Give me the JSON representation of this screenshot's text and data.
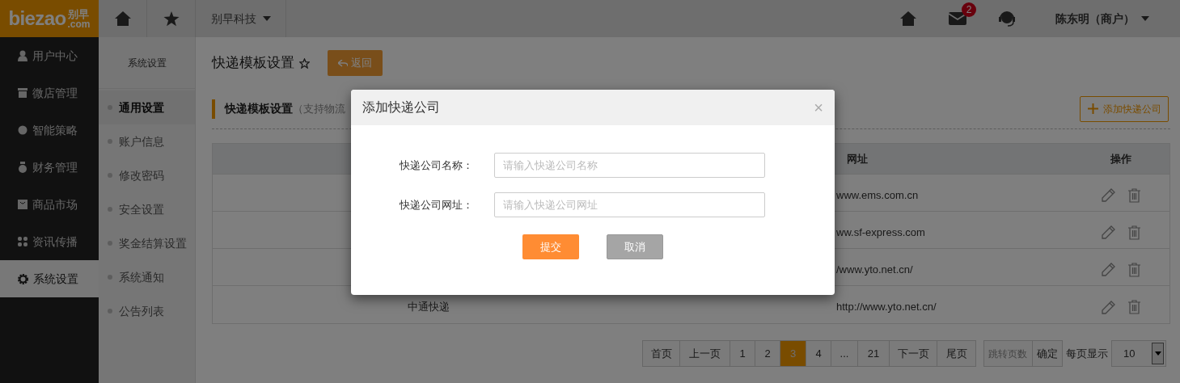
{
  "logo": {
    "text": "biezao",
    "cn": "别早",
    "domain": ".com"
  },
  "topbar": {
    "company": "别早科技",
    "mail_badge": "2",
    "user": "陈东明（商户）"
  },
  "sidebar": {
    "items": [
      {
        "label": "用户中心",
        "kind": "user",
        "selected": false
      },
      {
        "label": "微店管理",
        "kind": "shop",
        "selected": false
      },
      {
        "label": "智能策略",
        "kind": "bulb",
        "selected": false
      },
      {
        "label": "财务管理",
        "kind": "moneybag",
        "selected": false
      },
      {
        "label": "商品市场",
        "kind": "bag",
        "selected": false
      },
      {
        "label": "资讯传播",
        "kind": "grid",
        "selected": false
      },
      {
        "label": "系统设置",
        "kind": "gear",
        "selected": true
      }
    ]
  },
  "submenu": {
    "title": "系统设置",
    "items": [
      {
        "label": "通用设置",
        "selected": true
      },
      {
        "label": "账户信息",
        "selected": false
      },
      {
        "label": "修改密码",
        "selected": false
      },
      {
        "label": "安全设置",
        "selected": false
      },
      {
        "label": "奖金结算设置",
        "selected": false
      },
      {
        "label": "系统通知",
        "selected": false
      },
      {
        "label": "公告列表",
        "selected": false
      }
    ]
  },
  "page": {
    "title": "快递模板设置",
    "back_button": "返回"
  },
  "section": {
    "title": "快递模板设置",
    "note": "（支持物流",
    "add_button": "添加快递公司"
  },
  "table": {
    "columns": [
      "网址",
      "操作"
    ],
    "rows": [
      {
        "url": "www.ems.com.cn"
      },
      {
        "url": "ww.sf-express.com"
      },
      {
        "url": "/www.yto.net.cn/"
      },
      {
        "name": "中通快递",
        "url": "http://www.yto.net.cn/"
      }
    ]
  },
  "pagination": {
    "items": [
      {
        "label": "首页",
        "selected": false
      },
      {
        "label": "上一页",
        "selected": false
      },
      {
        "label": "1",
        "selected": false
      },
      {
        "label": "2",
        "selected": false
      },
      {
        "label": "3",
        "selected": true
      },
      {
        "label": "4",
        "selected": false
      },
      {
        "label": "...",
        "selected": false
      },
      {
        "label": "21",
        "selected": false
      },
      {
        "label": "下一页",
        "selected": false
      },
      {
        "label": "尾页",
        "selected": false
      }
    ],
    "jump_placeholder": "跳转页数",
    "confirm": "确定",
    "per_page_label": "每页显示",
    "per_page": "10"
  },
  "dialog": {
    "title": "添加快递公司",
    "close": "×",
    "fields": [
      {
        "label": "快递公司名称：",
        "placeholder": "请输入快递公司名称"
      },
      {
        "label": "快递公司网址：",
        "placeholder": "请输入快递公司网址"
      }
    ],
    "buttons": [
      {
        "label": "提交",
        "kind": "primary"
      },
      {
        "label": "取消",
        "kind": "secondary"
      }
    ]
  }
}
